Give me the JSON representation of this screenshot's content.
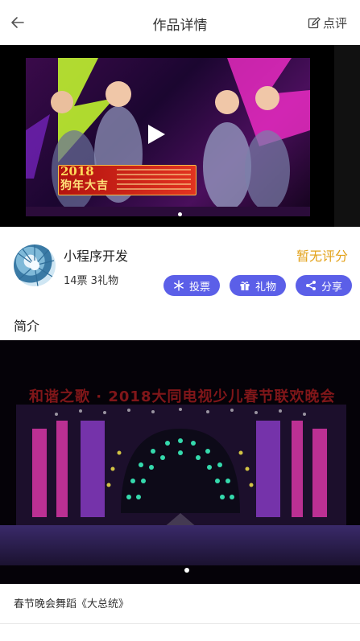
{
  "header": {
    "title": "作品详情",
    "comment_label": "点评"
  },
  "video": {
    "banner_year": "2018",
    "banner_main": "狗年大吉"
  },
  "work": {
    "author": "小程序开发",
    "stats": "14票 3礼物",
    "rating": "暂无评分",
    "actions": {
      "vote_label": "投票",
      "gift_label": "礼物",
      "share_label": "分享"
    }
  },
  "intro": {
    "section_title": "简介",
    "stage_banner": "和谐之歌 · 2018大同电视少儿春节联欢晚会",
    "caption": "春节晚会舞蹈《大总统》"
  },
  "colors": {
    "accent": "#5b5fe8",
    "rating": "#e3a21a"
  }
}
